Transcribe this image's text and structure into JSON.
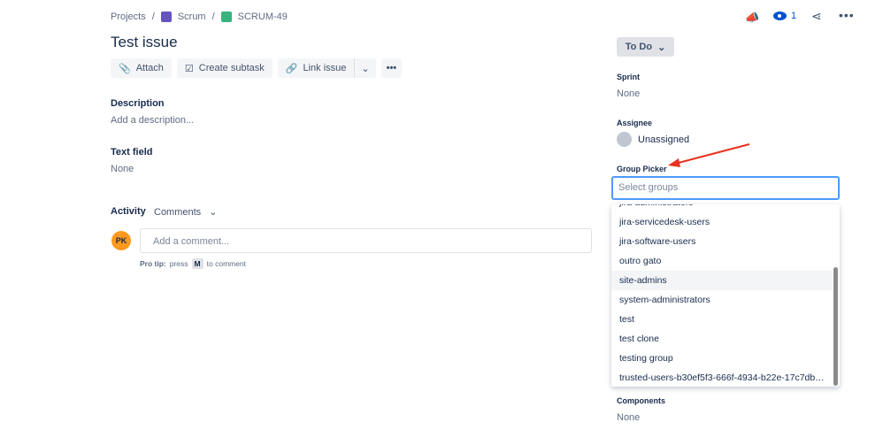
{
  "breadcrumbs": [
    "Projects",
    "Scrum",
    "SCRUM-49"
  ],
  "issue": {
    "title": "Test issue"
  },
  "toolbar": {
    "attach": "Attach",
    "create_subtask": "Create subtask",
    "link_issue": "Link issue"
  },
  "description": {
    "label": "Description",
    "placeholder": "Add a description..."
  },
  "text_field": {
    "label": "Text field",
    "value": "None"
  },
  "activity": {
    "label": "Activity",
    "filter": "Comments",
    "avatar_initials": "PK",
    "comment_placeholder": "Add a comment...",
    "tip_prefix": "Pro tip:",
    "tip_press": "press",
    "tip_key": "M",
    "tip_suffix": "to comment"
  },
  "header": {
    "watchers": "1"
  },
  "sidebar": {
    "status": "To Do",
    "sprint_label": "Sprint",
    "sprint_value": "None",
    "assignee_label": "Assignee",
    "assignee_value": "Unassigned",
    "group_picker_label": "Group Picker",
    "group_picker_placeholder": "Select groups",
    "components_label": "Components",
    "components_value": "None"
  },
  "group_options": [
    "jira-administrators",
    "jira-servicedesk-users",
    "jira-software-users",
    "outro gato",
    "site-admins",
    "system-administrators",
    "test",
    "test clone",
    "testing group",
    "trusted-users-b30ef5f3-666f-4934-b22e-17c7dbd..."
  ],
  "colors": {
    "accent": "#0052cc",
    "focus": "#4c9aff",
    "avatar": "#ff991f",
    "arrow": "#e8321f"
  }
}
